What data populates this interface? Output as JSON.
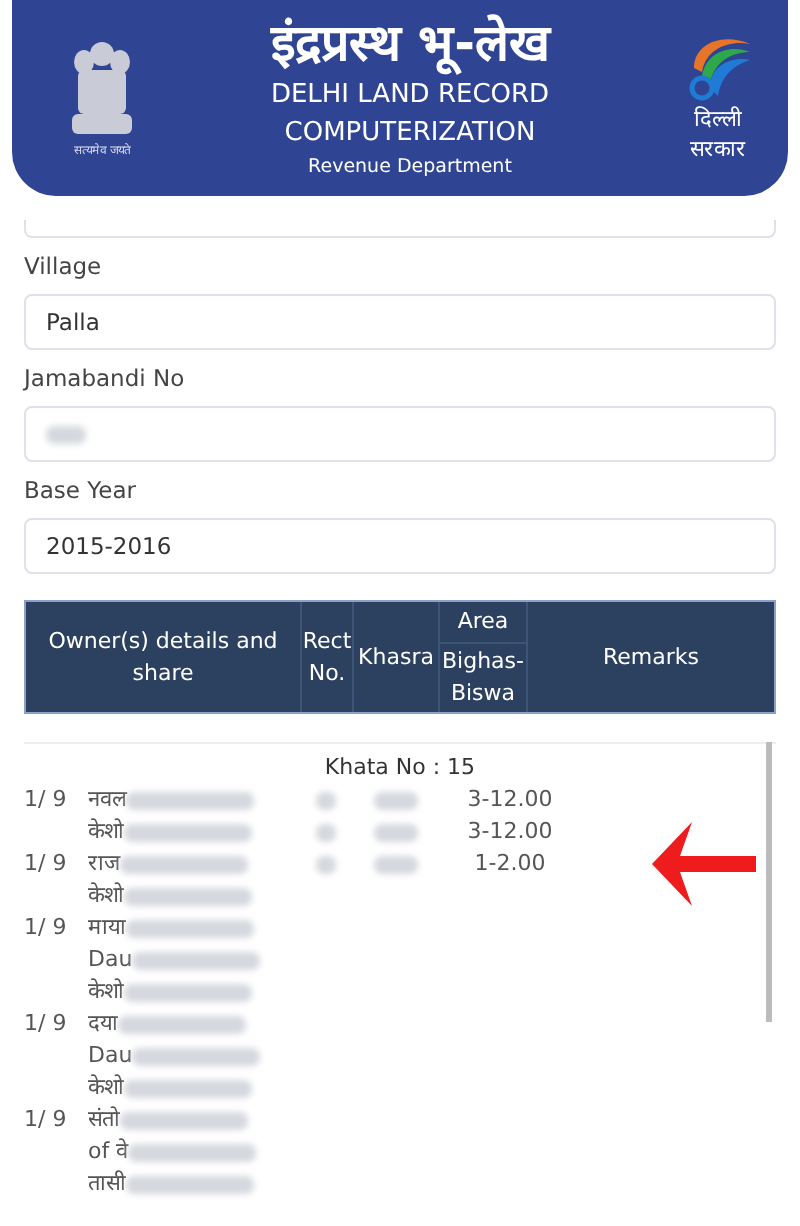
{
  "header": {
    "title": "इंद्रप्रस्थ भू-लेख",
    "line1": "DELHI LAND RECORD",
    "line2": "COMPUTERIZATION",
    "department": "Revenue Department",
    "emblem_motto": "सत्यमेव जयते",
    "logo_text": [
      "दिल्ली",
      "सरकार"
    ]
  },
  "form": {
    "fields": [
      {
        "label": "Village",
        "value": "Palla",
        "kind": "text"
      },
      {
        "label": "Jamabandi No",
        "kind": "redacted"
      },
      {
        "label": "Base Year",
        "value": "2015-2016",
        "kind": "text"
      }
    ]
  },
  "table": {
    "columns": [
      {
        "label": "Owner(s) details and share"
      },
      {
        "label": "Rect No."
      },
      {
        "label": "Khasra"
      },
      {
        "label": "Area",
        "sub": "Bighas-Biswa"
      },
      {
        "label": "Remarks"
      }
    ],
    "khata": "Khata No : 15",
    "lines": [
      {
        "share": "1/ 9",
        "name": "नवल",
        "area": "3-12.00"
      },
      {
        "name": "केशो",
        "area": "3-12.00"
      },
      {
        "share": "1/ 9",
        "name": "राज",
        "area": "1-2.00"
      },
      {
        "name": "केशो"
      },
      {
        "share": "1/ 9",
        "name": "माया"
      },
      {
        "name": "Dau"
      },
      {
        "name": "केशो"
      },
      {
        "share": "1/ 9",
        "name": "दया"
      },
      {
        "name": "Dau"
      },
      {
        "name": "केशो"
      },
      {
        "share": "1/ 9",
        "name": "संतो"
      },
      {
        "name": "of वे"
      },
      {
        "name": "तासी"
      }
    ]
  }
}
